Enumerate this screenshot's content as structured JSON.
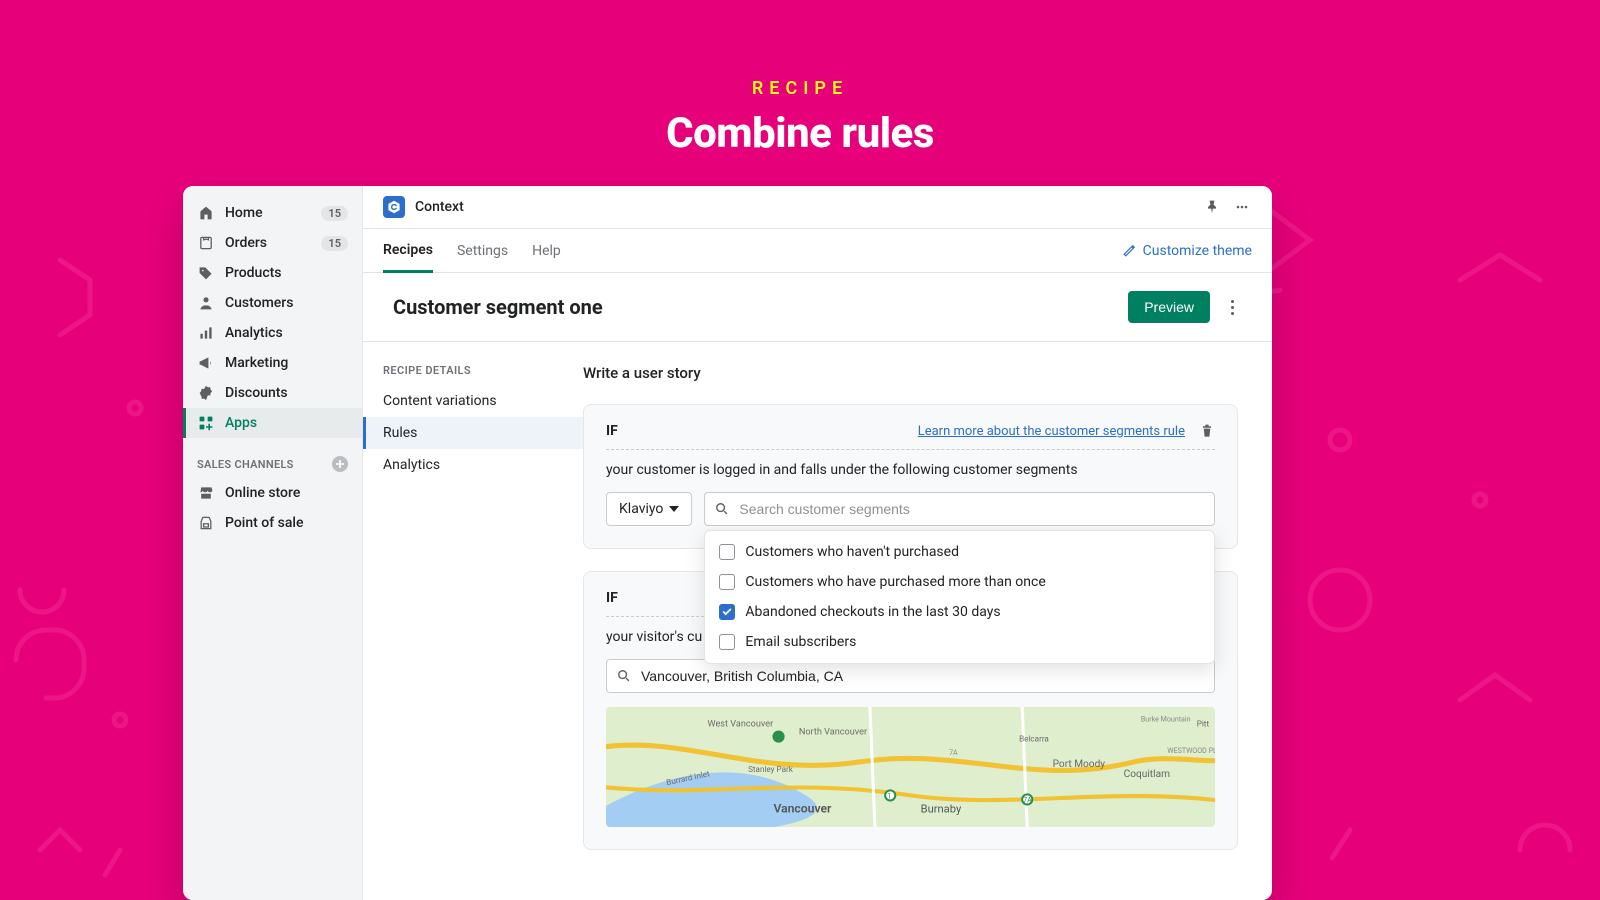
{
  "outer": {
    "eyebrow": "RECIPE",
    "title": "Combine rules"
  },
  "sidebar": {
    "items": [
      {
        "label": "Home",
        "badge": "15"
      },
      {
        "label": "Orders",
        "badge": "15"
      },
      {
        "label": "Products"
      },
      {
        "label": "Customers"
      },
      {
        "label": "Analytics"
      },
      {
        "label": "Marketing"
      },
      {
        "label": "Discounts"
      },
      {
        "label": "Apps",
        "active": true
      }
    ],
    "sales_heading": "SALES CHANNELS",
    "channels": [
      {
        "label": "Online store"
      },
      {
        "label": "Point of sale"
      }
    ]
  },
  "app": {
    "name": "Context",
    "tabs": {
      "recipes": "Recipes",
      "settings": "Settings",
      "help": "Help"
    },
    "customize": "Customize theme"
  },
  "page": {
    "title": "Customer segment one",
    "preview": "Preview"
  },
  "subnav": {
    "heading": "RECIPE DETAILS",
    "items": [
      {
        "label": "Content variations"
      },
      {
        "label": "Rules",
        "active": true
      },
      {
        "label": "Analytics"
      }
    ]
  },
  "form": {
    "story_title": "Write a user story",
    "if": "IF",
    "rule1": {
      "learn": "Learn more about the customer segments rule",
      "desc": "your customer is logged in and falls under the following customer segments",
      "provider": "Klaviyo",
      "search_ph": "Search customer segments",
      "options": [
        {
          "label": "Customers who haven't purchased",
          "checked": false
        },
        {
          "label": "Customers who have purchased more than once",
          "checked": false
        },
        {
          "label": "Abandoned checkouts in the last 30 days",
          "checked": true
        },
        {
          "label": "Email subscribers",
          "checked": false
        }
      ]
    },
    "rule2": {
      "desc_prefix": "your visitor's cu",
      "location": "Vancouver, British Columbia, CA"
    }
  }
}
